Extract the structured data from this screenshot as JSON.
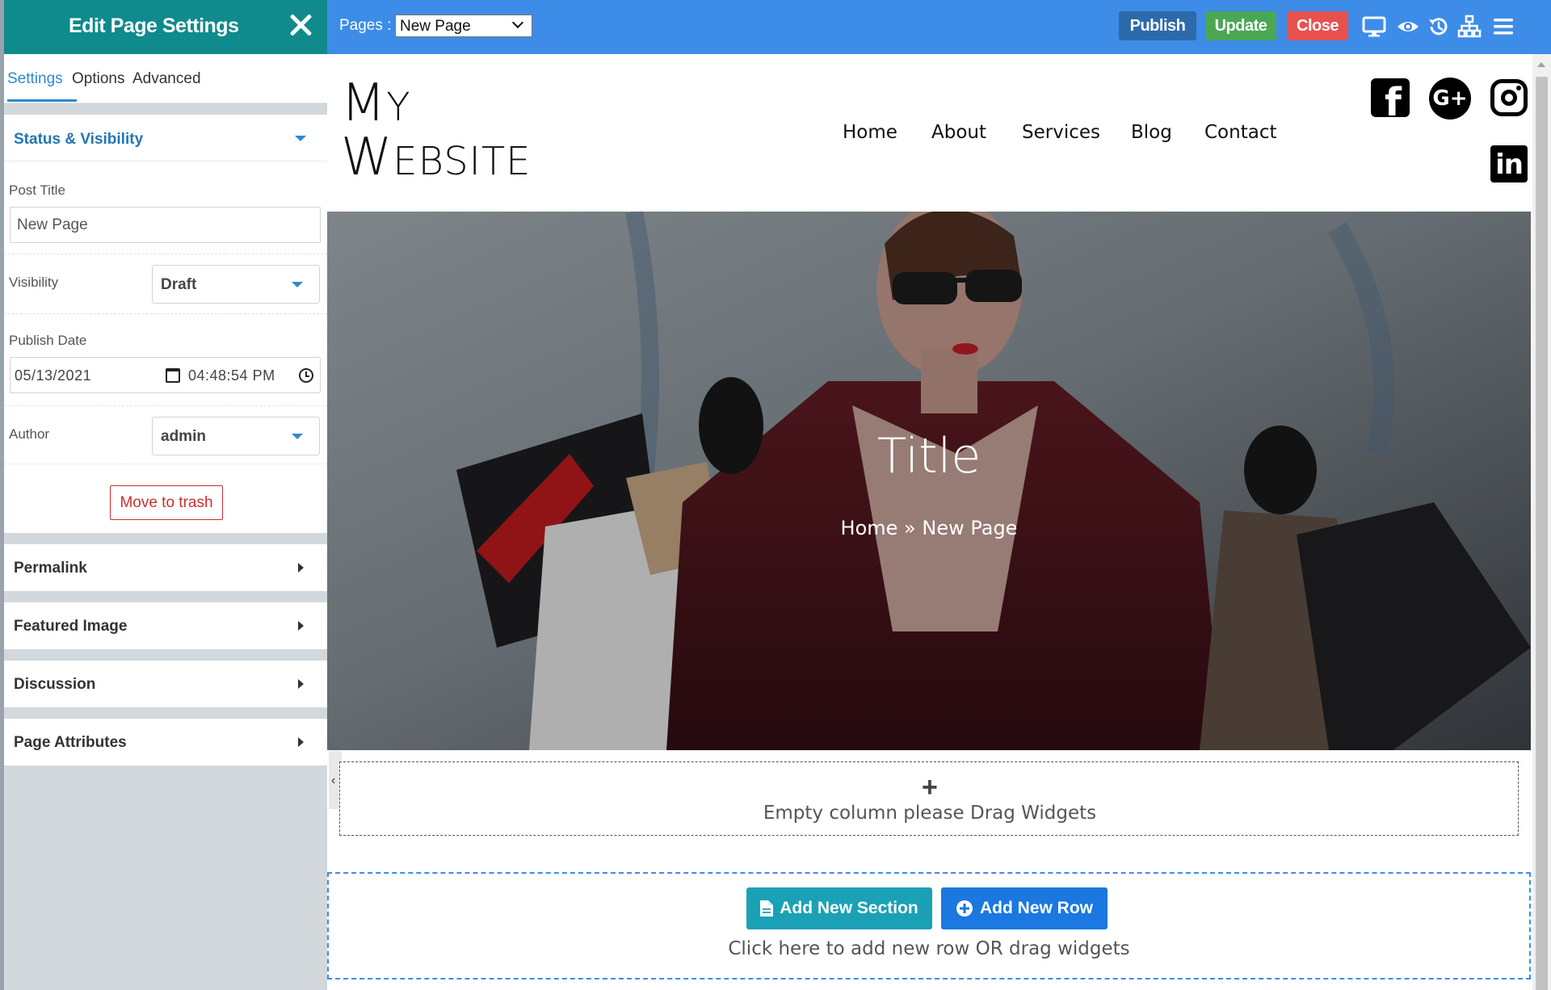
{
  "panel": {
    "title": "Edit Page Settings",
    "tabs": [
      {
        "label": "Settings",
        "active": true
      },
      {
        "label": "Options",
        "active": false
      },
      {
        "label": "Advanced",
        "active": false
      }
    ],
    "status_visibility": {
      "title": "Status & Visibility",
      "post_title_label": "Post Title",
      "post_title_value": "New Page",
      "visibility_label": "Visibility",
      "visibility_value": "Draft",
      "publish_date_label": "Publish Date",
      "date_value": "05/13/2021",
      "time_value": "04:48:54 PM",
      "author_label": "Author",
      "author_value": "admin",
      "trash_label": "Move to trash"
    },
    "sections": [
      {
        "label": "Permalink"
      },
      {
        "label": "Featured Image"
      },
      {
        "label": "Discussion"
      },
      {
        "label": "Page Attributes"
      }
    ]
  },
  "topbar": {
    "pages_label": "Pages :",
    "pages_selected": "New Page",
    "publish_label": "Publish",
    "update_label": "Update",
    "close_label": "Close",
    "icons": [
      "desktop-icon",
      "eye-icon",
      "history-icon",
      "sitemap-icon",
      "menu-icon"
    ]
  },
  "site": {
    "logo": {
      "line1_big": "M",
      "line1_small": "Y",
      "line2_big": "W",
      "line2_small": "EBSITE"
    },
    "nav": [
      {
        "label": "Home"
      },
      {
        "label": "About"
      },
      {
        "label": "Services"
      },
      {
        "label": "Blog"
      },
      {
        "label": "Contact"
      }
    ],
    "social": [
      "facebook-icon",
      "google-plus-icon",
      "instagram-icon",
      "linkedin-icon"
    ],
    "hero": {
      "title": "Title",
      "breadcrumb": "Home » New Page"
    }
  },
  "builder": {
    "empty_column_text": "Empty column please Drag Widgets",
    "add_section_label": "Add New Section",
    "add_row_label": "Add New Row",
    "hint": "Click here to add new row OR drag widgets"
  },
  "colors": {
    "panel_header": "#0f8a8d",
    "topbar": "#3d8ce8",
    "accent_blue": "#2a8bd0",
    "publish": "#2c6aab",
    "update": "#4aa854",
    "close": "#e8524e",
    "add_section": "#1aa1b6",
    "add_row": "#1a78e0"
  }
}
